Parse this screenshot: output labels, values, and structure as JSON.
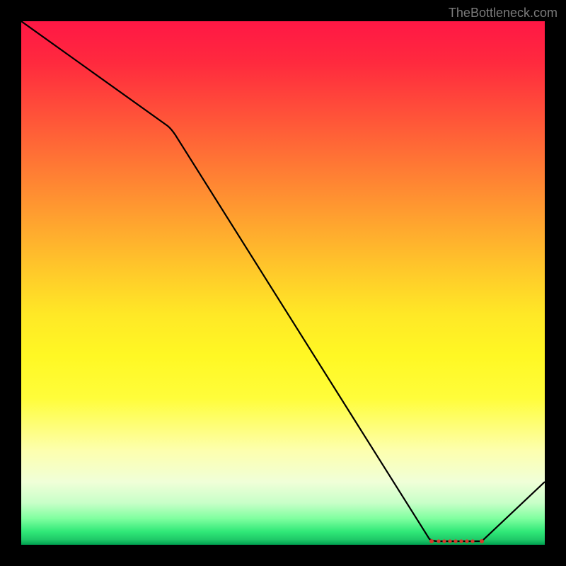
{
  "attribution": "TheBottleneck.com",
  "chart_data": {
    "type": "line",
    "title": "",
    "xlabel": "",
    "ylabel": "",
    "xlim": [
      0,
      100
    ],
    "ylim": [
      0,
      100
    ],
    "x": [
      0,
      28,
      78,
      82,
      88,
      100
    ],
    "values": [
      100,
      80,
      1,
      0.5,
      0.5,
      12
    ],
    "marker_cluster": {
      "x_start": 78,
      "x_end": 88,
      "y": 0.6,
      "count": 8
    },
    "gradient_stops": [
      {
        "pos": 0,
        "color": "#ff1745"
      },
      {
        "pos": 0.5,
        "color": "#ffe826"
      },
      {
        "pos": 0.82,
        "color": "#fdffae"
      },
      {
        "pos": 0.97,
        "color": "#30e878"
      },
      {
        "pos": 1.0,
        "color": "#00a050"
      }
    ]
  }
}
